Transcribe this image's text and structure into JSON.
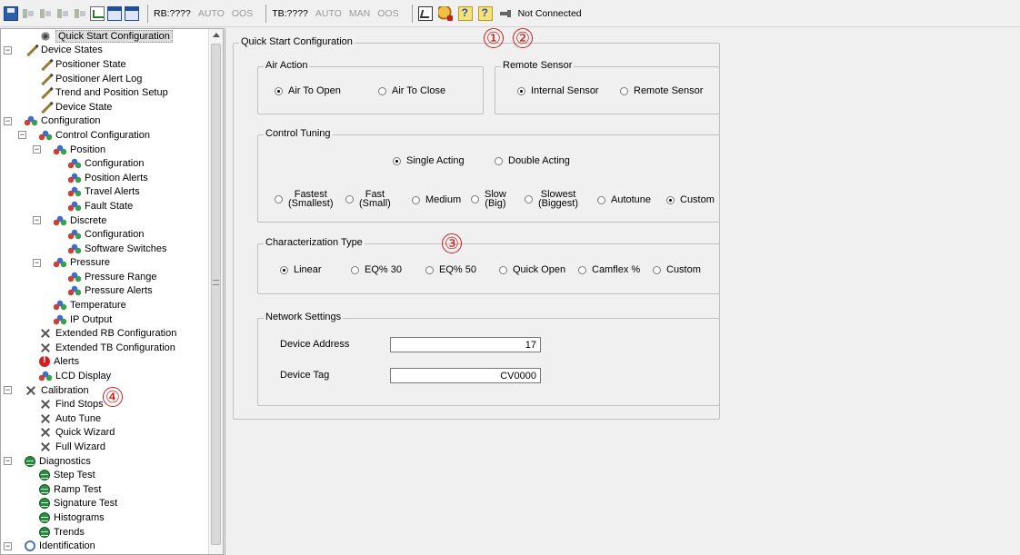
{
  "toolbar": {
    "rb_label": "RB:????",
    "rb_auto": "AUTO",
    "rb_oos": "OOS",
    "tb_label": "TB:????",
    "tb_auto": "AUTO",
    "tb_man": "MAN",
    "tb_oos": "OOS",
    "status": "Not Connected"
  },
  "tree": {
    "items": [
      {
        "label": "Quick Start Configuration",
        "icon": "gear-icon",
        "selected": true
      },
      {
        "label": "Device States",
        "icon": "pencil-icon"
      },
      {
        "label": "Positioner State",
        "icon": "pencil-icon"
      },
      {
        "label": "Positioner Alert Log",
        "icon": "pencil-icon"
      },
      {
        "label": "Trend and Position Setup",
        "icon": "pencil-icon"
      },
      {
        "label": "Device State",
        "icon": "pencil-icon"
      },
      {
        "label": "Configuration",
        "icon": "blocks-icon"
      },
      {
        "label": "Control Configuration",
        "icon": "blocks-icon"
      },
      {
        "label": "Position",
        "icon": "blocks-icon"
      },
      {
        "label": "Configuration",
        "icon": "blocks-icon"
      },
      {
        "label": "Position Alerts",
        "icon": "blocks-icon"
      },
      {
        "label": "Travel Alerts",
        "icon": "blocks-icon"
      },
      {
        "label": "Fault State",
        "icon": "blocks-icon"
      },
      {
        "label": "Discrete",
        "icon": "blocks-icon"
      },
      {
        "label": "Configuration",
        "icon": "blocks-icon"
      },
      {
        "label": "Software Switches",
        "icon": "blocks-icon"
      },
      {
        "label": "Pressure",
        "icon": "blocks-icon"
      },
      {
        "label": "Pressure Range",
        "icon": "blocks-icon"
      },
      {
        "label": "Pressure Alerts",
        "icon": "blocks-icon"
      },
      {
        "label": "Temperature",
        "icon": "blocks-icon"
      },
      {
        "label": "IP Output",
        "icon": "blocks-icon"
      },
      {
        "label": "Extended RB Configuration",
        "icon": "tools-icon"
      },
      {
        "label": "Extended TB Configuration",
        "icon": "tools-icon"
      },
      {
        "label": "Alerts",
        "icon": "alert-icon"
      },
      {
        "label": "LCD Display",
        "icon": "blocks-icon"
      },
      {
        "label": "Calibration",
        "icon": "tools-icon"
      },
      {
        "label": "Find Stops",
        "icon": "tools-icon"
      },
      {
        "label": "Auto Tune",
        "icon": "tools-icon"
      },
      {
        "label": "Quick Wizard",
        "icon": "tools-icon"
      },
      {
        "label": "Full Wizard",
        "icon": "tools-icon"
      },
      {
        "label": "Diagnostics",
        "icon": "diagnostics-icon"
      },
      {
        "label": "Step Test",
        "icon": "diagnostics-icon"
      },
      {
        "label": "Ramp Test",
        "icon": "diagnostics-icon"
      },
      {
        "label": "Signature Test",
        "icon": "diagnostics-icon"
      },
      {
        "label": "Histograms",
        "icon": "diagnostics-icon"
      },
      {
        "label": "Trends",
        "icon": "diagnostics-icon"
      },
      {
        "label": "Identification",
        "icon": "identification-icon"
      }
    ]
  },
  "callouts": {
    "c1": "①",
    "c2": "②",
    "c3": "③",
    "c4": "④"
  },
  "quick_start": {
    "title": "Quick Start Configuration",
    "air_action": {
      "title": "Air Action",
      "options": [
        "Air To Open",
        "Air To Close"
      ],
      "selected": "Air To Open"
    },
    "remote_sensor": {
      "title": "Remote Sensor",
      "options": [
        "Internal Sensor",
        "Remote Sensor"
      ],
      "selected": "Internal Sensor"
    },
    "control_tuning": {
      "title": "Control Tuning",
      "acting_options": [
        "Single Acting",
        "Double Acting"
      ],
      "acting_selected": "Single Acting",
      "speed_options": [
        {
          "line1": "Fastest",
          "line2": "(Smallest)"
        },
        {
          "line1": "Fast",
          "line2": "(Small)"
        },
        {
          "line1": "Medium",
          "line2": ""
        },
        {
          "line1": "Slow",
          "line2": "(Big)"
        },
        {
          "line1": "Slowest",
          "line2": "(Biggest)"
        },
        {
          "line1": "Autotune",
          "line2": ""
        },
        {
          "line1": "Custom",
          "line2": ""
        }
      ],
      "speed_selected": "Custom"
    },
    "characterization": {
      "title": "Characterization Type",
      "options": [
        "Linear",
        "EQ% 30",
        "EQ% 50",
        "Quick Open",
        "Camflex %",
        "Custom"
      ],
      "selected": "Linear"
    },
    "network": {
      "title": "Network Settings",
      "device_address_label": "Device Address",
      "device_address_value": "17",
      "device_tag_label": "Device Tag",
      "device_tag_value": "CV0000"
    }
  }
}
